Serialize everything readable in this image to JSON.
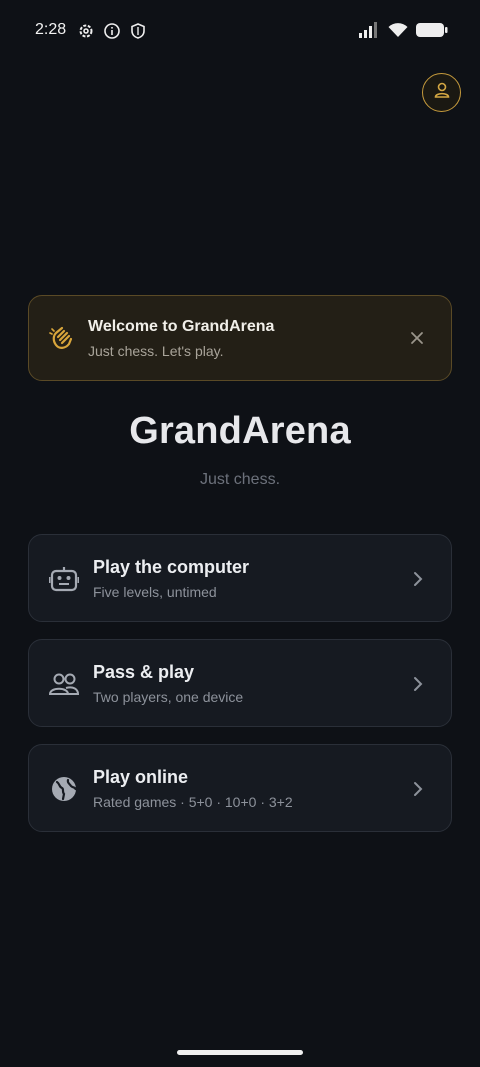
{
  "status_bar": {
    "time": "2:28"
  },
  "banner": {
    "title": "Welcome to GrandArena",
    "subtitle": "Just chess. Let's play."
  },
  "app": {
    "title": "GrandArena",
    "tagline": "Just chess."
  },
  "menu": [
    {
      "title": "Play the computer",
      "subtitle": "Five levels, untimed",
      "icon": "robot-icon"
    },
    {
      "title": "Pass & play",
      "subtitle": "Two players, one device",
      "icon": "people-icon"
    },
    {
      "title": "Play online",
      "subtitle": "Rated games · 5+0 · 10+0 · 3+2",
      "icon": "globe-icon"
    }
  ],
  "colors": {
    "background": "#0e1116",
    "accent": "#c59a3c",
    "card": "#161a21"
  }
}
